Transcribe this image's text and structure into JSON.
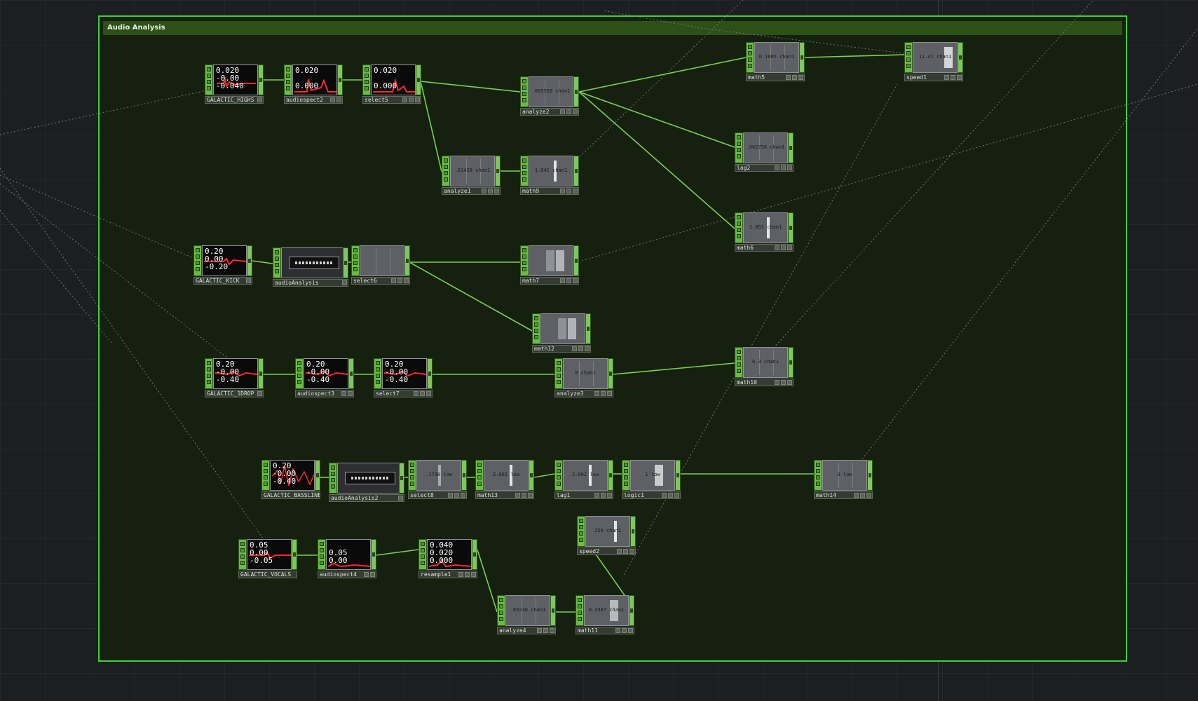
{
  "container": {
    "title": "Audio Analysis"
  },
  "colors": {
    "background": "#1c1e22",
    "container_border": "#3fcf3a",
    "container_fill": "#16200f",
    "title_bar": "#2c5018",
    "wire": "#7ccf4f",
    "node_strip": "#6cbb46"
  },
  "nodes": {
    "galactic_highs": {
      "name": "GALACTIC_HIGHS",
      "line1": "0.020",
      "line2": "-0.00",
      "line3": "-0.040",
      "channel": "chan1"
    },
    "audiospect2": {
      "name": "audiospect2",
      "line1": "0.020",
      "line2": "0.000",
      "channel": "chan1"
    },
    "select5": {
      "name": "select5",
      "line1": "0.020",
      "line2": "0.000",
      "channel": "chan1"
    },
    "analyze2": {
      "name": "analyze2",
      "readout": ".005558 chan1"
    },
    "math5": {
      "name": "math5",
      "readout": "0.1005 chan1"
    },
    "speed1": {
      "name": "speed1",
      "readout": "11.41 chan1"
    },
    "lag2": {
      "name": "lag2",
      "readout": ".002756 chan1"
    },
    "analyze1": {
      "name": "analyze1",
      "readout": ".01428 chan1"
    },
    "math9": {
      "name": "math9",
      "readout": "1.041 chan1"
    },
    "math6": {
      "name": "math6",
      "readout": "1.051 chan1"
    },
    "galactic_kick": {
      "name": "GALACTIC_KICK",
      "line1": "0.20",
      "line2": "0.00",
      "line3": "-0.20",
      "channel": "chan1"
    },
    "audioanalysis": {
      "name": "audioAnalysis"
    },
    "select6": {
      "name": "select6"
    },
    "math7": {
      "name": "math7"
    },
    "math12": {
      "name": "math12"
    },
    "galactic_1drop": {
      "name": "GALACTIC_1DROP",
      "line1": "0.20",
      "line2": "-0.00",
      "line3": "-0.40",
      "channel": "chan1"
    },
    "audiospect3": {
      "name": "audiospect3",
      "line1": "0.20",
      "line2": "-0.00",
      "line3": "-0.40",
      "channel": "chan1"
    },
    "select7": {
      "name": "select7",
      "line1": "0.20",
      "line2": "-0.00",
      "line3": "-0.40",
      "channel": "chan1"
    },
    "analyze3": {
      "name": "analyze3",
      "readout": "0 chan1"
    },
    "math10": {
      "name": "math10",
      "readout": "0.3 chan1"
    },
    "galactic_bassline": {
      "name": "GALACTIC_BASSLINE",
      "line1": "0.20",
      "line2": "-0.00",
      "line3": "-0.40",
      "channel": "chan1"
    },
    "audioanalysis2": {
      "name": "audioAnalysis2"
    },
    "select8": {
      "name": "select8",
      "readout": ".1738 low"
    },
    "math13": {
      "name": "math13",
      "readout": "2.002 low"
    },
    "lag1": {
      "name": "lag1",
      "readout": "2.002 low"
    },
    "logic1": {
      "name": "logic1",
      "readout": "1 low"
    },
    "math14": {
      "name": "math14",
      "readout": "0 low"
    },
    "speed2": {
      "name": "speed2",
      "readout": "256 chan1"
    },
    "galactic_vocals": {
      "name": "GALACTIC_VOCALS",
      "line1": "0.05",
      "line2": "0.00",
      "line3": "-0.05",
      "channel": "chan1"
    },
    "audiospect4": {
      "name": "audiospect4",
      "line1": "0.05",
      "line2": "0.00",
      "channel": "chan1"
    },
    "resample1": {
      "name": "resample1",
      "line1": "0.040",
      "line2": "0.020",
      "line3": "0.000",
      "channel": "chan1"
    },
    "analyze4": {
      "name": "analyze4",
      "readout": ".03236 chan1"
    },
    "math11": {
      "name": "math11",
      "readout": "0.3387 chan1"
    }
  }
}
